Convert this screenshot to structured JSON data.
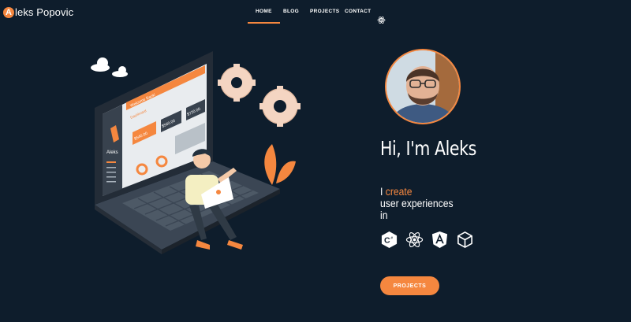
{
  "brand": {
    "logo_letter": "A",
    "name": "leks Popovic"
  },
  "nav": {
    "items": [
      {
        "label": "HOME",
        "active": true
      },
      {
        "label": "BLOG"
      },
      {
        "label": "PROJECTS"
      },
      {
        "label": "CONTACT"
      }
    ],
    "theme_icon": "react-atom-icon"
  },
  "illustration": {
    "welcome_text": "Welcome Back!",
    "dashboard_label": "Dashboard",
    "sidebar_brand": "Aleks",
    "cards": [
      "$540.00",
      "$560.00",
      "$720.00"
    ]
  },
  "hero": {
    "greeting": "Hi, I'm Aleks",
    "tagline_prefix": "I",
    "tagline_accent": "create",
    "tagline_line2": "user experiences",
    "tagline_line3": "in",
    "tech": [
      "csharp-icon",
      "react-icon",
      "angular-icon",
      "unity-icon"
    ],
    "cta_label": "PROJECTS"
  },
  "colors": {
    "background": "#0e1d2c",
    "accent": "#f5873f",
    "text": "#ffffff"
  }
}
